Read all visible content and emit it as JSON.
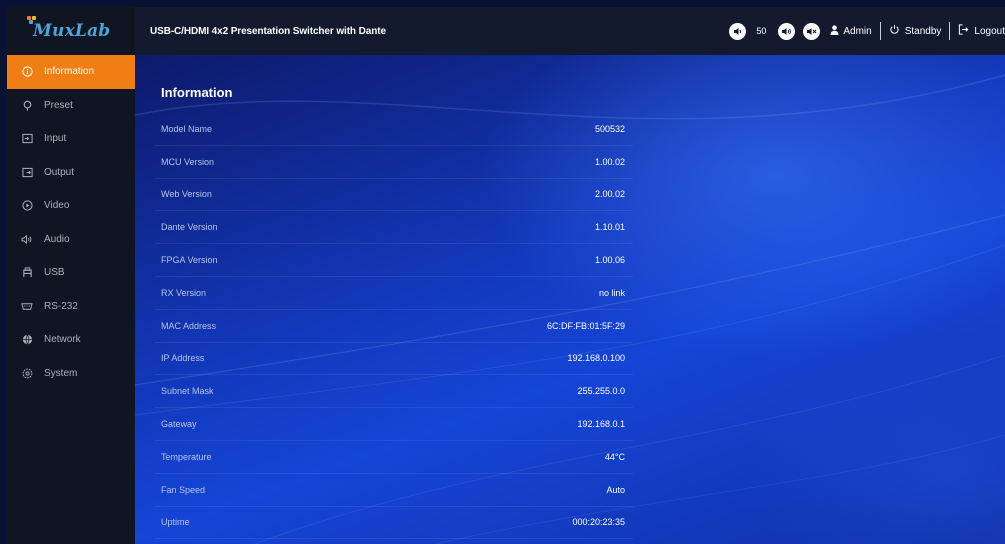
{
  "brand": {
    "logo_text": "MuxLab",
    "accent_color": "#f07e12"
  },
  "header": {
    "title": "USB-C/HDMI 4x2 Presentation Switcher with Dante",
    "volume_value": "50",
    "user_label": "Admin",
    "standby_label": "Standby",
    "logout_label": "Logout"
  },
  "sidebar": {
    "items": [
      {
        "label": "Information",
        "icon": "info-icon",
        "active": true
      },
      {
        "label": "Preset",
        "icon": "preset-pin-icon"
      },
      {
        "label": "Input",
        "icon": "input-icon"
      },
      {
        "label": "Output",
        "icon": "output-icon"
      },
      {
        "label": "Video",
        "icon": "video-icon"
      },
      {
        "label": "Audio",
        "icon": "audio-icon"
      },
      {
        "label": "USB",
        "icon": "usb-icon"
      },
      {
        "label": "RS-232",
        "icon": "rs232-icon"
      },
      {
        "label": "Network",
        "icon": "globe-icon"
      },
      {
        "label": "System",
        "icon": "system-icon"
      }
    ]
  },
  "main": {
    "section_title": "Information",
    "rows": [
      {
        "label": "Model Name",
        "value": "500532"
      },
      {
        "label": "MCU Version",
        "value": "1.00.02"
      },
      {
        "label": "Web Version",
        "value": "2.00.02"
      },
      {
        "label": "Dante Version",
        "value": "1.10.01"
      },
      {
        "label": "FPGA Version",
        "value": "1.00.06"
      },
      {
        "label": "RX Version",
        "value": "no link"
      },
      {
        "label": "MAC Address",
        "value": "6C:DF:FB:01:5F:29"
      },
      {
        "label": "IP Address",
        "value": "192.168.0.100"
      },
      {
        "label": "Subnet Mask",
        "value": "255.255.0.0"
      },
      {
        "label": "Gateway",
        "value": "192.168.0.1"
      },
      {
        "label": "Temperature",
        "value": "44°C"
      },
      {
        "label": "Fan Speed",
        "value": "Auto"
      },
      {
        "label": "Uptime",
        "value": "000:20:23:35"
      }
    ]
  }
}
